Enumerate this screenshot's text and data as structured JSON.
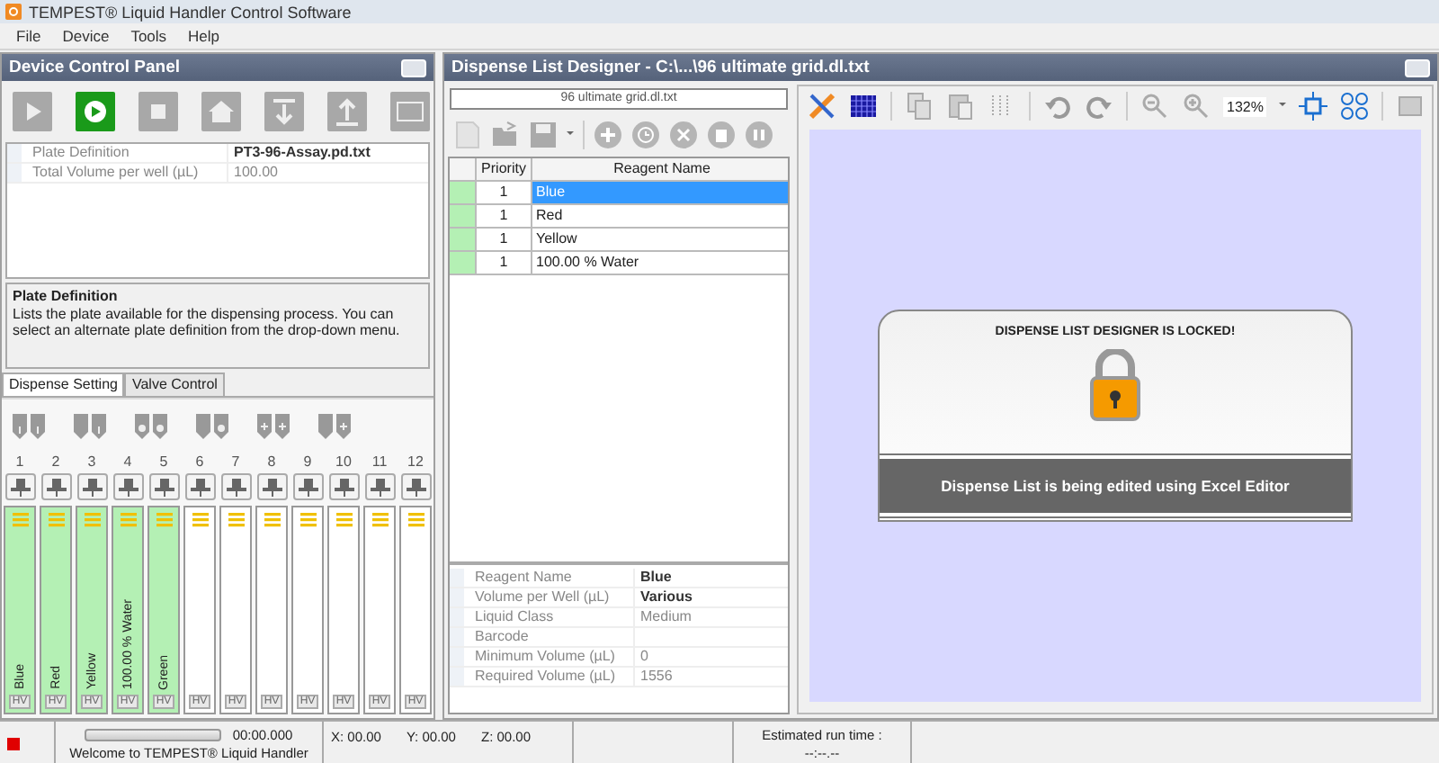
{
  "window": {
    "title": "TEMPEST® Liquid Handler Control Software"
  },
  "menu": [
    "File",
    "Device",
    "Tools",
    "Help"
  ],
  "device_panel": {
    "title": "Device Control Panel",
    "properties": [
      {
        "name": "Plate Definition",
        "value": "PT3-96-Assay.pd.txt",
        "bold": true
      },
      {
        "name": "Total Volume per well (µL)",
        "value": "100.00",
        "bold": false
      }
    ],
    "description": {
      "title": "Plate Definition",
      "text": "Lists the plate available for the dispensing process. You can select an alternate plate definition from the drop-down menu."
    },
    "tabs": [
      {
        "label": "Dispense Setting",
        "selected": true
      },
      {
        "label": "Valve Control",
        "selected": false
      }
    ],
    "channels": [
      {
        "number": "1",
        "filled": true,
        "reagent": "Blue",
        "hv": "HV"
      },
      {
        "number": "2",
        "filled": true,
        "reagent": "Red",
        "hv": "HV"
      },
      {
        "number": "3",
        "filled": true,
        "reagent": "Yellow",
        "hv": "HV"
      },
      {
        "number": "4",
        "filled": true,
        "reagent": "100.00 % Water",
        "hv": "HV"
      },
      {
        "number": "5",
        "filled": true,
        "reagent": "Green",
        "hv": "HV"
      },
      {
        "number": "6",
        "filled": false,
        "hv": "HV"
      },
      {
        "number": "7",
        "filled": false,
        "hv": "HV"
      },
      {
        "number": "8",
        "filled": false,
        "hv": "HV"
      },
      {
        "number": "9",
        "filled": false,
        "hv": "HV"
      },
      {
        "number": "10",
        "filled": false,
        "hv": "HV"
      },
      {
        "number": "11",
        "filled": false,
        "hv": "HV"
      },
      {
        "number": "12",
        "filled": false,
        "hv": "HV"
      }
    ]
  },
  "designer": {
    "title": "Dispense List Designer - C:\\...\\96 ultimate grid.dl.txt",
    "file": "96 ultimate grid.dl.txt",
    "columns": [
      "Priority",
      "Reagent Name"
    ],
    "rows": [
      {
        "priority": "1",
        "name": "Blue",
        "selected": true
      },
      {
        "priority": "1",
        "name": "Red",
        "selected": false
      },
      {
        "priority": "1",
        "name": "Yellow",
        "selected": false
      },
      {
        "priority": "1",
        "name": "100.00 % Water",
        "selected": false
      }
    ],
    "properties": [
      {
        "name": "Reagent Name",
        "value": "Blue",
        "bold": true
      },
      {
        "name": "Volume per Well (µL)",
        "value": "Various",
        "bold": true
      },
      {
        "name": "Liquid Class",
        "value": "Medium",
        "bold": false
      },
      {
        "name": "Barcode"
      },
      {
        "name": "Minimum Volume (µL)",
        "value": "0",
        "bold": false
      },
      {
        "name": "Required Volume (µL)",
        "value": "1556",
        "bold": false
      }
    ],
    "zoom": "132%",
    "lock": {
      "title": "DISPENSE LIST DESIGNER IS LOCKED!",
      "message": "Dispense List is being edited using Excel Editor"
    }
  },
  "status_bar": {
    "progress": {
      "level": 0
    },
    "time": "00:00.000",
    "welcome": "Welcome to TEMPEST® Liquid Handler",
    "x": "X: 00.00",
    "y": "Y: 00.00",
    "z": "Z: 00.00",
    "estimate_label": "Estimated run time :",
    "estimate_value": "--:--.--"
  }
}
